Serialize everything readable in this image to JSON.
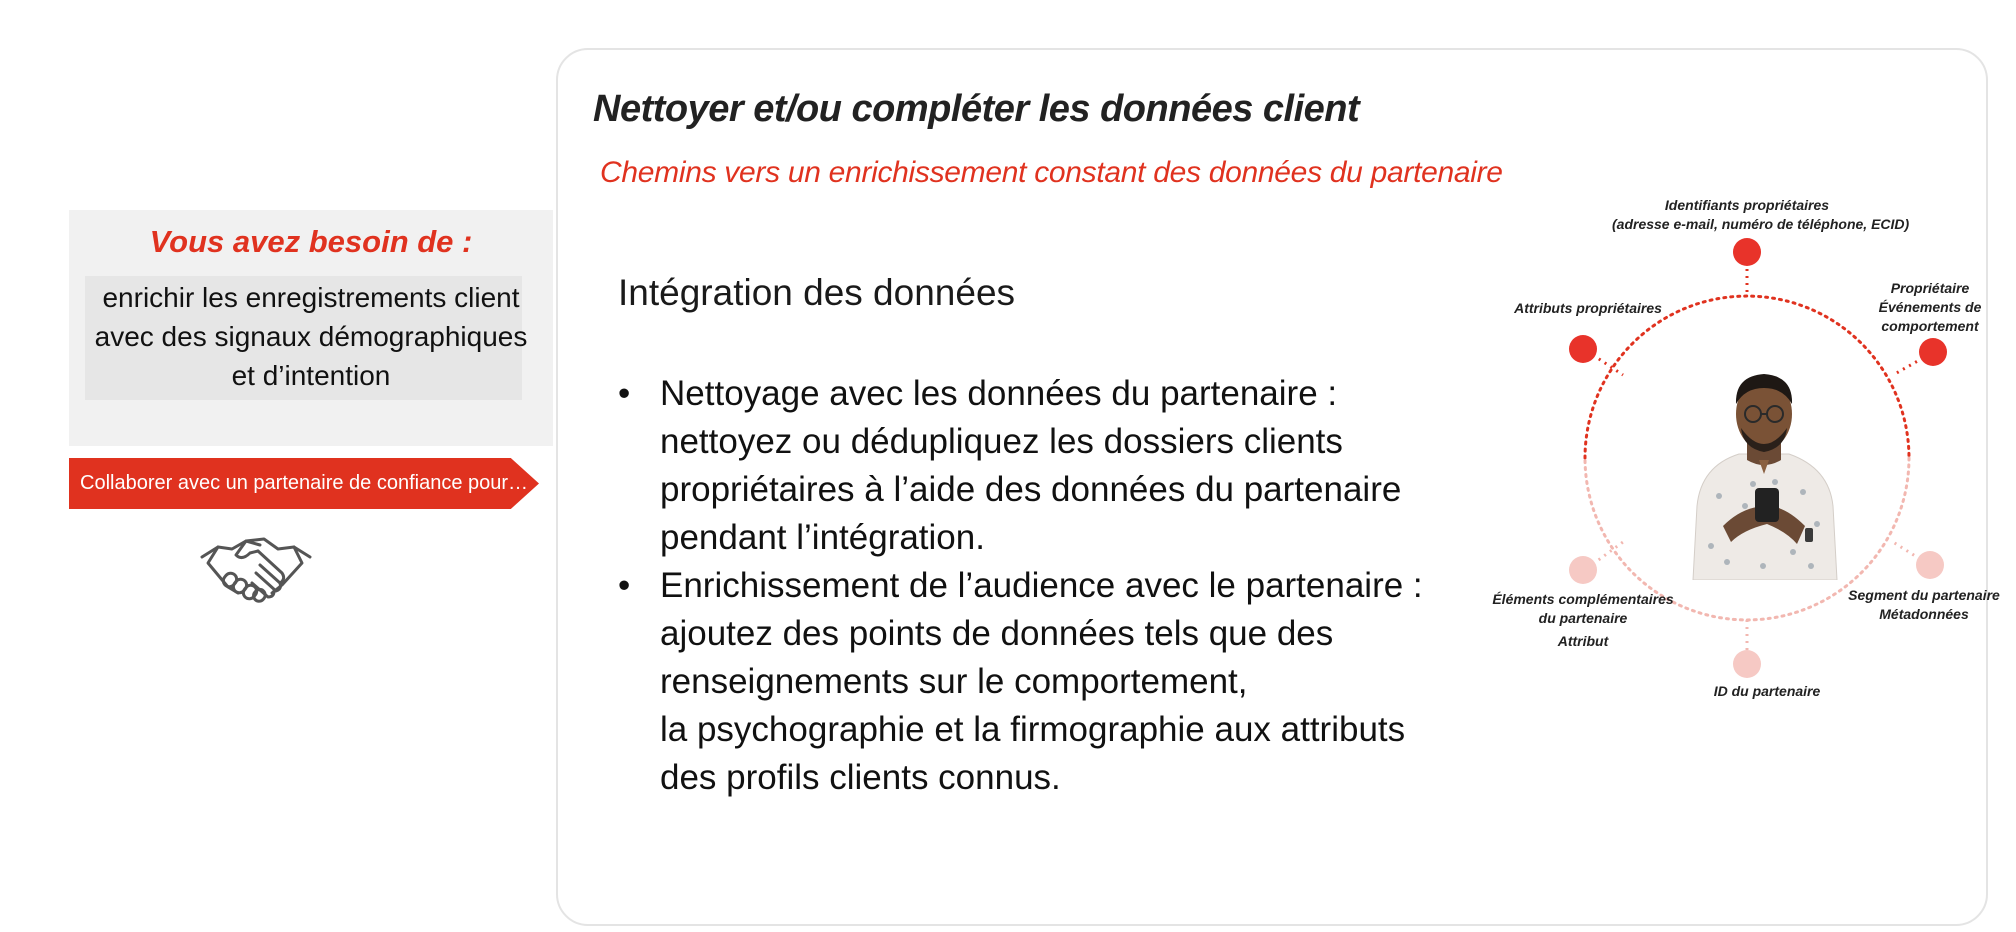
{
  "left": {
    "need_title": "Vous avez besoin de :",
    "need_lines": [
      "enrichir les enregistrements client",
      "avec des signaux démographiques",
      "et d’intention"
    ],
    "banner": "Collaborer avec un partenaire de confiance pour…",
    "icon": "handshake-icon"
  },
  "card": {
    "title": "Nettoyer et/ou compléter les données client",
    "subtitle": "Chemins vers un enrichissement constant des données du partenaire",
    "section_heading": "Intégration des données",
    "bullets": [
      {
        "lines": [
          "Nettoyage avec les données du partenaire :",
          "nettoyez ou dédupliquez les dossiers clients",
          "propriétaires à l’aide des données du partenaire",
          "pendant l’intégration."
        ]
      },
      {
        "lines": [
          "Enrichissement de l’audience avec le partenaire :",
          "ajoutez des points de données tels que des",
          "renseignements sur le comportement,",
          "la psychographie et la firmographie aux attributs",
          "des profils clients connus."
        ]
      }
    ]
  },
  "diagram": {
    "labels": {
      "top_1": "Identifiants propriétaires",
      "top_2": "(adresse e-mail, numéro de téléphone, ECID)",
      "left_top": "Attributs propriétaires",
      "right_top_1": "Propriétaire",
      "right_top_2": "Événements de",
      "right_top_3": "comportement",
      "left_bottom_1": "Éléments complémentaires",
      "left_bottom_2": "du partenaire",
      "left_bottom_3": "Attribut",
      "right_bottom_1": "Segment du partenaire",
      "right_bottom_2": "Métadonnées",
      "bottom": "ID du partenaire"
    },
    "colors": {
      "own": "#e8332a",
      "partner": "#f6c9c4",
      "ring_top": "#e0321f",
      "ring_bottom": "#f2b7b0"
    }
  }
}
